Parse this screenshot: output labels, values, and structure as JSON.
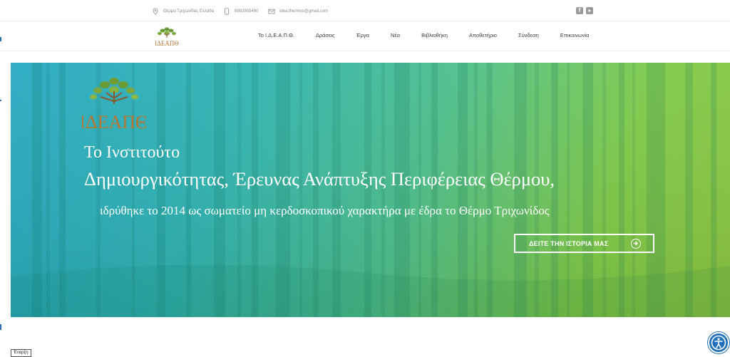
{
  "topbar": {
    "address": "Θέρμο Τριχωνίδας Ελλάδα",
    "phone": "6982905460",
    "email": "idea.thermos@gmail.com",
    "icons": {
      "address": "location-pin-icon",
      "phone": "phone-icon",
      "email": "email-icon"
    },
    "social": [
      {
        "icon": "facebook-icon"
      },
      {
        "icon": "youtube-icon"
      }
    ]
  },
  "nav": {
    "logo_text": "ΙΔΕΑΠΘ",
    "items": [
      {
        "label": "Το Ι.Δ.Ε.Α.Π.Θ."
      },
      {
        "label": "Δράσεις"
      },
      {
        "label": "Έργα"
      },
      {
        "label": "Νέα"
      },
      {
        "label": "Βιβλιοθήκη"
      },
      {
        "label": "Αποθετήριο"
      },
      {
        "label": "Σύνδεση"
      },
      {
        "label": "Επικοινωνία"
      }
    ]
  },
  "hero": {
    "logo_text": "ΙΔΕΑΠΘ",
    "title_line1": "Το Ινστιτούτο",
    "title_line2": "Δημιουργικότητας, Έρευνας Ανάπτυξης Περιφέρειας Θέρμου,",
    "subtitle": "ιδρύθηκε το 2014 ως σωματείο μη κερδοσκοπικού χαρακτήρα με έδρα το Θέρμο Τριχωνίδος",
    "button_label": "ΔΕΙΤΕ ΤΗΝ ΙΣΤΟΡΙΑ ΜΑΣ",
    "button_icon": "arrow-right-circle-icon",
    "colors": {
      "gradient_start": "#27a9c2",
      "gradient_end": "#8cc63f",
      "text": "#ffffff"
    }
  },
  "footer": {
    "corner_label": "Έναρξη"
  },
  "accessibility": {
    "icon": "accessibility-icon",
    "color": "#1f6fba"
  }
}
